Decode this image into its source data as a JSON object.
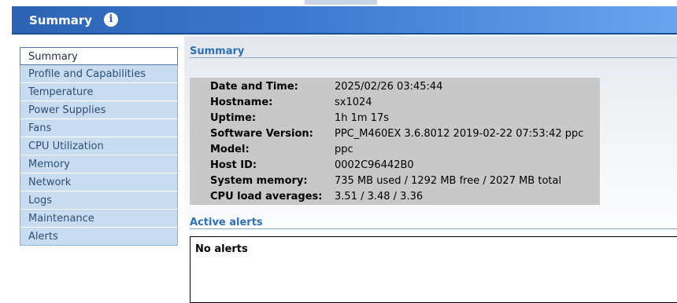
{
  "header": {
    "title": "Summary",
    "info_icon": "info-icon"
  },
  "sidebar": {
    "items": [
      {
        "label": "Summary",
        "active": true
      },
      {
        "label": "Profile and Capabilities"
      },
      {
        "label": "Temperature"
      },
      {
        "label": "Power Supplies"
      },
      {
        "label": "Fans"
      },
      {
        "label": "CPU Utilization"
      },
      {
        "label": "Memory"
      },
      {
        "label": "Network"
      },
      {
        "label": "Logs"
      },
      {
        "label": "Maintenance"
      },
      {
        "label": "Alerts"
      }
    ]
  },
  "summary": {
    "title": "Summary",
    "rows": [
      {
        "label": "Date and Time:",
        "value": "2025/02/26 03:45:44"
      },
      {
        "label": "Hostname:",
        "value": "sx1024"
      },
      {
        "label": "Uptime:",
        "value": "1h 1m 17s"
      },
      {
        "label": "Software Version:",
        "value": "PPC_M460EX 3.6.8012 2019-02-22 07:53:42 ppc"
      },
      {
        "label": "Model:",
        "value": "ppc"
      },
      {
        "label": "Host ID:",
        "value": "0002C96442B0"
      },
      {
        "label": "System memory:",
        "value": "735 MB used / 1292 MB free / 2027 MB total"
      },
      {
        "label": "CPU load averages:",
        "value": "3.51 / 3.48 / 3.36"
      }
    ]
  },
  "alerts": {
    "title": "Active alerts",
    "message": "No alerts"
  },
  "colors": {
    "banner": "#2c63b4",
    "nav_bg": "#c9dcef",
    "nav_text": "#2b4f7a",
    "section_title": "#2f6fb7",
    "info_box_bg": "#c8c8c8"
  }
}
